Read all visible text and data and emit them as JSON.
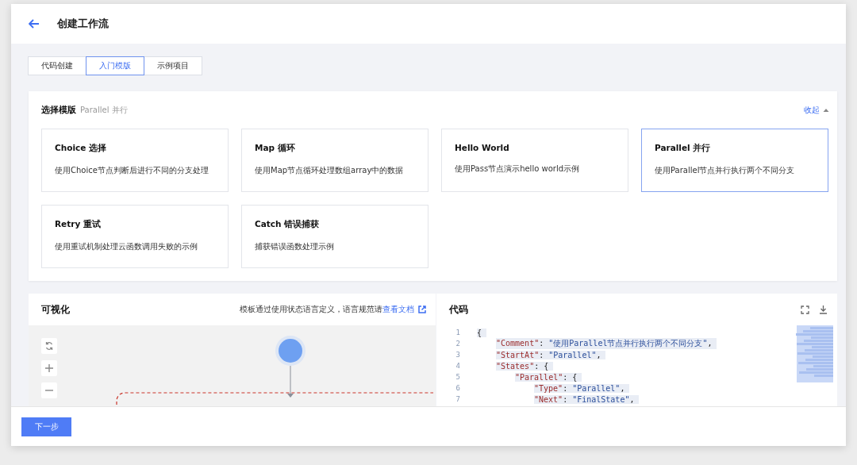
{
  "header": {
    "title": "创建工作流"
  },
  "tabs": [
    {
      "label": "代码创建",
      "selected": false
    },
    {
      "label": "入门模版",
      "selected": true
    },
    {
      "label": "示例项目",
      "selected": false
    }
  ],
  "template_panel": {
    "title": "选择模版",
    "current": "Parallel 并行",
    "collapse": "收起",
    "cards": [
      {
        "title": "Choice 选择",
        "desc": "使用Choice节点判断后进行不同的分支处理",
        "selected": false
      },
      {
        "title": "Map 循环",
        "desc": "使用Map节点循环处理数组array中的数据",
        "selected": false
      },
      {
        "title": "Hello World",
        "desc": "使用Pass节点演示hello world示例",
        "selected": false
      },
      {
        "title": "Parallel 并行",
        "desc": "使用Parallel节点并行执行两个不同分支",
        "selected": true
      },
      {
        "title": "Retry 重试",
        "desc": "使用重试机制处理云函数调用失败的示例",
        "selected": false
      },
      {
        "title": "Catch 错误捕获",
        "desc": "捕获错误函数处理示例",
        "selected": false
      }
    ]
  },
  "visual_panel": {
    "title": "可视化",
    "note": "模板通过使用状态语言定义，语言规范请",
    "doc_link": "查看文档"
  },
  "code_panel": {
    "title": "代码",
    "lines": [
      {
        "num": "1",
        "parts": [
          {
            "kind": "punct",
            "text": "{"
          }
        ],
        "children": [
          {
            "num": "2",
            "parts": [
              {
                "kind": "key",
                "text": "\"Comment\""
              },
              {
                "kind": "punct",
                "text": ": "
              },
              {
                "kind": "str",
                "text": "\"使用Parallel节点并行执行两个不同分支\""
              },
              {
                "kind": "punct",
                "text": ","
              }
            ]
          },
          {
            "num": "3",
            "parts": [
              {
                "kind": "key",
                "text": "\"StartAt\""
              },
              {
                "kind": "punct",
                "text": ": "
              },
              {
                "kind": "str",
                "text": "\"Parallel\""
              },
              {
                "kind": "punct",
                "text": ","
              }
            ]
          },
          {
            "num": "4",
            "parts": [
              {
                "kind": "key",
                "text": "\"States\""
              },
              {
                "kind": "punct",
                "text": ": {"
              }
            ],
            "children": [
              {
                "num": "5",
                "parts": [
                  {
                    "kind": "key",
                    "text": "\"Parallel\""
                  },
                  {
                    "kind": "punct",
                    "text": ": {"
                  }
                ],
                "children": [
                  {
                    "num": "6",
                    "parts": [
                      {
                        "kind": "key",
                        "text": "\"Type\""
                      },
                      {
                        "kind": "punct",
                        "text": ": "
                      },
                      {
                        "kind": "str",
                        "text": "\"Parallel\""
                      },
                      {
                        "kind": "punct",
                        "text": ","
                      }
                    ]
                  },
                  {
                    "num": "7",
                    "parts": [
                      {
                        "kind": "key",
                        "text": "\"Next\""
                      },
                      {
                        "kind": "punct",
                        "text": ": "
                      },
                      {
                        "kind": "str",
                        "text": "\"FinalState\""
                      },
                      {
                        "kind": "punct",
                        "text": ","
                      }
                    ]
                  }
                ]
              }
            ]
          }
        ]
      }
    ]
  },
  "footer": {
    "next_button": "下一步"
  }
}
